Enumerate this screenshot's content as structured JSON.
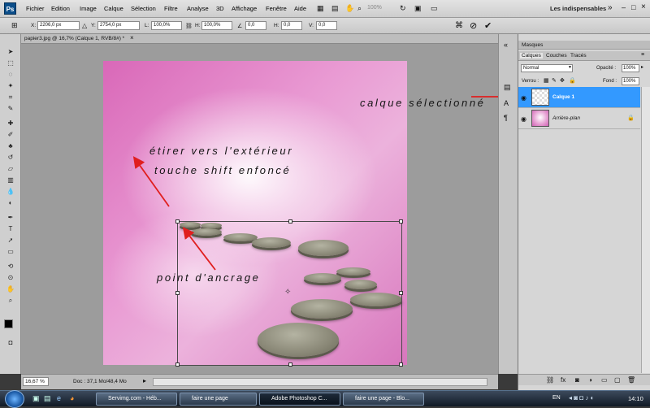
{
  "app": {
    "logo": "Ps",
    "workspace": "Les indispensables",
    "zoom_combo": "100%"
  },
  "menu": [
    "Fichier",
    "Edition",
    "Image",
    "Calque",
    "Sélection",
    "Filtre",
    "Analyse",
    "3D",
    "Affichage",
    "Fenêtre",
    "Aide"
  ],
  "options": {
    "x_label": "X:",
    "x_value": "2206,0 px",
    "y_label": "Y:",
    "y_value": "2754,0 px",
    "l_label": "L:",
    "l_value": "100,0%",
    "h_label": "H:",
    "h_value": "100,0%",
    "angle_value": "0,0",
    "hh_label": "H:",
    "hh_value": "0,0",
    "v_label": "V:",
    "v_value": "0,0"
  },
  "document": {
    "tab_title": "papier3.jpg @ 16,7% (Calque 1, RVB/8#) *",
    "zoom": "16,67 %",
    "doc_info": "Doc : 37,1 Mo/48,4 Mo"
  },
  "annotations": {
    "stretch_line1": "étirer vers l'extérieur",
    "stretch_line2": "touche shift enfoncé",
    "anchor": "point d'ancrage",
    "selected_layer": "calque sélectionné"
  },
  "layers_panel": {
    "masks_tab": "Masques",
    "tabs": [
      "Calques",
      "Couches",
      "Tracés"
    ],
    "blend_mode": "Normal",
    "opacity_label": "Opacité :",
    "opacity_value": "100%",
    "lock_label": "Verrou :",
    "fill_label": "Fond :",
    "fill_value": "100%",
    "layers": [
      {
        "name": "Calque 1",
        "selected": true
      },
      {
        "name": "Arrière-plan",
        "selected": false
      }
    ]
  },
  "taskbar": {
    "items": [
      "Servimg.com - Héb...",
      "faire une page",
      "Adobe Photoshop C...",
      "faire une page - Blo..."
    ],
    "lang": "EN",
    "time": "14:10"
  },
  "colors": {
    "accent": "#3399ff",
    "arrow": "#e01e1e"
  }
}
